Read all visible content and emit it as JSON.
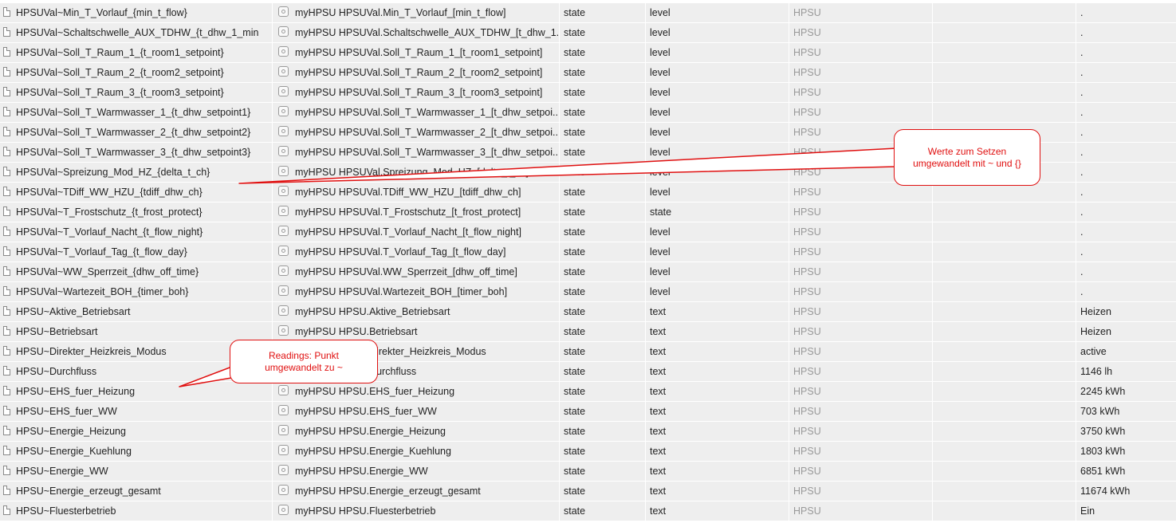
{
  "rows": [
    {
      "name": "HPSUVal~Min_T_Vorlauf_{min_t_flow}",
      "object": "myHPSU HPSUVal.Min_T_Vorlauf_[min_t_flow]",
      "type": "state",
      "role": "level",
      "room": "HPSU",
      "function": "",
      "value": "."
    },
    {
      "name": "HPSUVal~Schaltschwelle_AUX_TDHW_{t_dhw_1_min",
      "object": "myHPSU HPSUVal.Schaltschwelle_AUX_TDHW_[t_dhw_1...",
      "type": "state",
      "role": "level",
      "room": "HPSU",
      "function": "",
      "value": "."
    },
    {
      "name": "HPSUVal~Soll_T_Raum_1_{t_room1_setpoint}",
      "object": "myHPSU HPSUVal.Soll_T_Raum_1_[t_room1_setpoint]",
      "type": "state",
      "role": "level",
      "room": "HPSU",
      "function": "",
      "value": "."
    },
    {
      "name": "HPSUVal~Soll_T_Raum_2_{t_room2_setpoint}",
      "object": "myHPSU HPSUVal.Soll_T_Raum_2_[t_room2_setpoint]",
      "type": "state",
      "role": "level",
      "room": "HPSU",
      "function": "",
      "value": "."
    },
    {
      "name": "HPSUVal~Soll_T_Raum_3_{t_room3_setpoint}",
      "object": "myHPSU HPSUVal.Soll_T_Raum_3_[t_room3_setpoint]",
      "type": "state",
      "role": "level",
      "room": "HPSU",
      "function": "",
      "value": "."
    },
    {
      "name": "HPSUVal~Soll_T_Warmwasser_1_{t_dhw_setpoint1}",
      "object": "myHPSU HPSUVal.Soll_T_Warmwasser_1_[t_dhw_setpoi...",
      "type": "state",
      "role": "level",
      "room": "HPSU",
      "function": "",
      "value": "."
    },
    {
      "name": "HPSUVal~Soll_T_Warmwasser_2_{t_dhw_setpoint2}",
      "object": "myHPSU HPSUVal.Soll_T_Warmwasser_2_[t_dhw_setpoi...",
      "type": "state",
      "role": "level",
      "room": "HPSU",
      "function": "",
      "value": "."
    },
    {
      "name": "HPSUVal~Soll_T_Warmwasser_3_{t_dhw_setpoint3}",
      "object": "myHPSU HPSUVal.Soll_T_Warmwasser_3_[t_dhw_setpoi...",
      "type": "state",
      "role": "level",
      "room": "HPSU",
      "function": "",
      "value": "."
    },
    {
      "name": "HPSUVal~Spreizung_Mod_HZ_{delta_t_ch}",
      "object": "myHPSU HPSUVal.Spreizung_Mod_HZ_[delta_t_ch]",
      "type": "state",
      "role": "level",
      "room": "HPSU",
      "function": "",
      "value": "."
    },
    {
      "name": "HPSUVal~TDiff_WW_HZU_{tdiff_dhw_ch}",
      "object": "myHPSU HPSUVal.TDiff_WW_HZU_[tdiff_dhw_ch]",
      "type": "state",
      "role": "level",
      "room": "HPSU",
      "function": "",
      "value": "."
    },
    {
      "name": "HPSUVal~T_Frostschutz_{t_frost_protect}",
      "object": "myHPSU HPSUVal.T_Frostschutz_[t_frost_protect]",
      "type": "state",
      "role": "state",
      "room": "HPSU",
      "function": "",
      "value": "."
    },
    {
      "name": "HPSUVal~T_Vorlauf_Nacht_{t_flow_night}",
      "object": "myHPSU HPSUVal.T_Vorlauf_Nacht_[t_flow_night]",
      "type": "state",
      "role": "level",
      "room": "HPSU",
      "function": "",
      "value": "."
    },
    {
      "name": "HPSUVal~T_Vorlauf_Tag_{t_flow_day}",
      "object": "myHPSU HPSUVal.T_Vorlauf_Tag_[t_flow_day]",
      "type": "state",
      "role": "level",
      "room": "HPSU",
      "function": "",
      "value": "."
    },
    {
      "name": "HPSUVal~WW_Sperrzeit_{dhw_off_time}",
      "object": "myHPSU HPSUVal.WW_Sperrzeit_[dhw_off_time]",
      "type": "state",
      "role": "level",
      "room": "HPSU",
      "function": "",
      "value": "."
    },
    {
      "name": "HPSUVal~Wartezeit_BOH_{timer_boh}",
      "object": "myHPSU HPSUVal.Wartezeit_BOH_[timer_boh]",
      "type": "state",
      "role": "level",
      "room": "HPSU",
      "function": "",
      "value": "."
    },
    {
      "name": "HPSU~Aktive_Betriebsart",
      "object": "myHPSU HPSU.Aktive_Betriebsart",
      "type": "state",
      "role": "text",
      "room": "HPSU",
      "function": "",
      "value": "Heizen"
    },
    {
      "name": "HPSU~Betriebsart",
      "object": "myHPSU HPSU.Betriebsart",
      "type": "state",
      "role": "text",
      "room": "HPSU",
      "function": "",
      "value": "Heizen"
    },
    {
      "name": "HPSU~Direkter_Heizkreis_Modus",
      "object": "myHPSU HPSU.Direkter_Heizkreis_Modus",
      "type": "state",
      "role": "text",
      "room": "HPSU",
      "function": "",
      "value": "active"
    },
    {
      "name": "HPSU~Durchfluss",
      "object": "myHPSU HPSU.Durchfluss",
      "type": "state",
      "role": "text",
      "room": "HPSU",
      "function": "",
      "value": "1146 lh"
    },
    {
      "name": "HPSU~EHS_fuer_Heizung",
      "object": "myHPSU HPSU.EHS_fuer_Heizung",
      "type": "state",
      "role": "text",
      "room": "HPSU",
      "function": "",
      "value": "2245 kWh"
    },
    {
      "name": "HPSU~EHS_fuer_WW",
      "object": "myHPSU HPSU.EHS_fuer_WW",
      "type": "state",
      "role": "text",
      "room": "HPSU",
      "function": "",
      "value": "703 kWh"
    },
    {
      "name": "HPSU~Energie_Heizung",
      "object": "myHPSU HPSU.Energie_Heizung",
      "type": "state",
      "role": "text",
      "room": "HPSU",
      "function": "",
      "value": "3750 kWh"
    },
    {
      "name": "HPSU~Energie_Kuehlung",
      "object": "myHPSU HPSU.Energie_Kuehlung",
      "type": "state",
      "role": "text",
      "room": "HPSU",
      "function": "",
      "value": "1803 kWh"
    },
    {
      "name": "HPSU~Energie_WW",
      "object": "myHPSU HPSU.Energie_WW",
      "type": "state",
      "role": "text",
      "room": "HPSU",
      "function": "",
      "value": "6851 kWh"
    },
    {
      "name": "HPSU~Energie_erzeugt_gesamt",
      "object": "myHPSU HPSU.Energie_erzeugt_gesamt",
      "type": "state",
      "role": "text",
      "room": "HPSU",
      "function": "",
      "value": "11674 kWh"
    },
    {
      "name": "HPSU~Fluesterbetrieb",
      "object": "myHPSU HPSU.Fluesterbetrieb",
      "type": "state",
      "role": "text",
      "room": "HPSU",
      "function": "",
      "value": "Ein"
    }
  ],
  "annotations": {
    "setpoint_note": "Werte zum Setzen\numgewandelt mit ~ und {}",
    "readings_note": "Readings: Punkt\numgewandelt zu ~"
  },
  "colors": {
    "row_background": "#eeeeee",
    "room_text": "#999999",
    "annotation_red": "#e01010"
  },
  "icons": {
    "name_column": "document-icon",
    "object_column": "state-object-icon"
  }
}
